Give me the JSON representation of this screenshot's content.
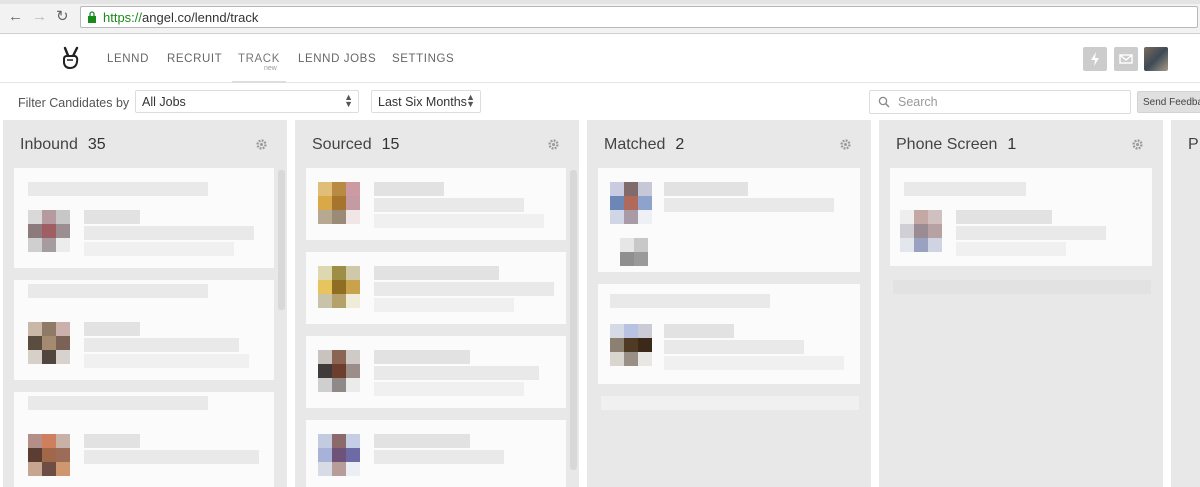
{
  "browser": {
    "url_scheme": "https://",
    "url_rest": "angel.co/lennd/track"
  },
  "nav": {
    "items": [
      {
        "label": "LENND"
      },
      {
        "label": "RECRUIT"
      },
      {
        "label": "TRACK",
        "sublabel": "new",
        "active": true
      },
      {
        "label": "LENND JOBS"
      },
      {
        "label": "SETTINGS"
      }
    ],
    "icons": [
      "logo-peace-hand-icon",
      "lightning-icon",
      "mail-icon",
      "avatar"
    ]
  },
  "filter": {
    "label": "Filter Candidates by",
    "job_select": "All Jobs",
    "time_select": "Last Six Months",
    "search_placeholder": "Search",
    "feedback_button": "Send Feedback"
  },
  "columns": [
    {
      "name": "Inbound",
      "count": "35"
    },
    {
      "name": "Sourced",
      "count": "15"
    },
    {
      "name": "Matched",
      "count": "2"
    },
    {
      "name": "Phone Screen",
      "count": "1"
    },
    {
      "name": "P",
      "count": ""
    }
  ],
  "colors": {
    "accent_green": "#1a8a1a",
    "column_bg": "#e8e8e9",
    "card_bg": "#fbfbfb"
  }
}
